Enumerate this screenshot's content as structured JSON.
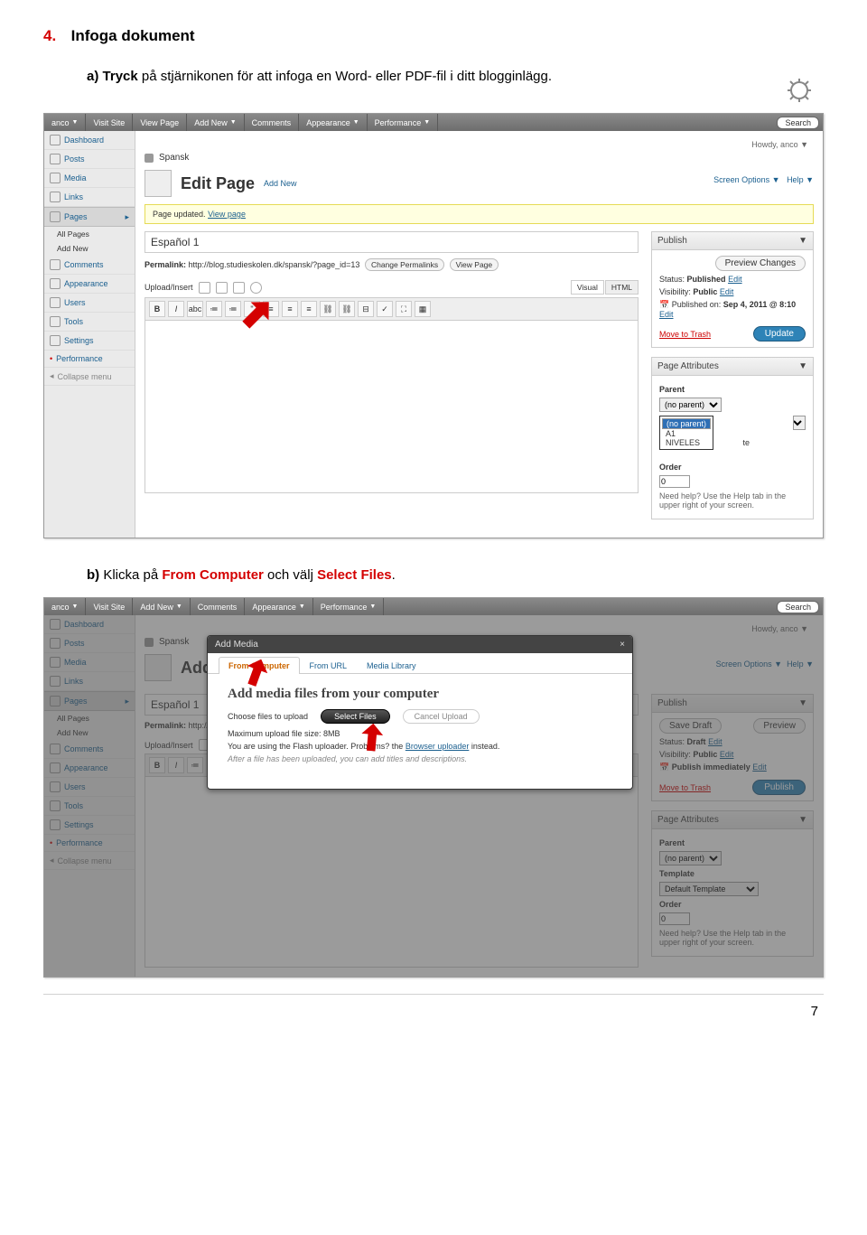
{
  "section": {
    "num": "4.",
    "title": "Infoga dokument"
  },
  "para_a": {
    "prefix": "a)",
    "bold": "Tryck",
    "rest": " på stjärnikonen för att infoga en Word- eller PDF-fil i ditt blogginlägg."
  },
  "topbar": {
    "site": "anco",
    "items": [
      "Visit Site",
      "View Page",
      "Add New",
      "Comments",
      "Appearance",
      "Performance"
    ],
    "search": "Search"
  },
  "howdy": "Howdy, anco",
  "breadcrumb": "Spansk",
  "edit_page": {
    "title": "Edit Page",
    "add_new": "Add New"
  },
  "screen_opts": "Screen Options",
  "help": "Help",
  "notice": {
    "text": "Page updated.",
    "link": "View page"
  },
  "editor": {
    "title": "Español 1",
    "permalink_label": "Permalink:",
    "permalink": "http://blog.studieskolen.dk/spansk/?page_id=13",
    "btn1": "Change Permalinks",
    "btn2": "View Page",
    "upload": "Upload/Insert",
    "tabs": [
      "Visual",
      "HTML"
    ]
  },
  "sidebar_s1": [
    {
      "label": "Dashboard"
    },
    {
      "label": "Posts"
    },
    {
      "label": "Media"
    },
    {
      "label": "Links"
    },
    {
      "label": "Pages",
      "active": true,
      "subs": [
        "All Pages",
        "Add New"
      ]
    },
    {
      "label": "Comments"
    },
    {
      "label": "Appearance"
    },
    {
      "label": "Users"
    },
    {
      "label": "Tools"
    },
    {
      "label": "Settings"
    },
    {
      "label": "Performance"
    }
  ],
  "collapse": "Collapse menu",
  "publish": {
    "h": "Publish",
    "preview": "Preview Changes",
    "status": "Status:",
    "status_v": "Published",
    "edit": "Edit",
    "vis": "Visibility:",
    "vis_v": "Public",
    "pub_on": "Published on:",
    "pub_v": "Sep 4, 2011 @ 8:10",
    "trash": "Move to Trash",
    "update": "Update"
  },
  "attrs": {
    "h": "Page Attributes",
    "parent": "Parent",
    "parent_v": "(no parent)",
    "dd": [
      "(no parent)",
      "A1",
      "NIVELES"
    ],
    "tmpl_hint": "te",
    "order": "Order",
    "order_v": "0",
    "help": "Need help? Use the Help tab in the upper right of your screen."
  },
  "para_b": {
    "prefix": "b)",
    "t1": " Klicka på ",
    "r1": "From Computer",
    "t2": " och välj ",
    "r2": "Select Files",
    "t3": "."
  },
  "s2": {
    "edit_title": "Add New",
    "status_v": "Draft",
    "vis_v": "Public",
    "pub_on": "Publish immediately",
    "save": "Save Draft",
    "preview": "Preview",
    "publish": "Publish",
    "tmpl": "Template",
    "tmpl_v": "Default Template"
  },
  "modal": {
    "h": "Add Media",
    "close": "×",
    "tabs": [
      "From Computer",
      "From URL",
      "Media Library"
    ],
    "title": "Add media files from your computer",
    "choose": "Choose files to upload",
    "select": "Select Files",
    "cancel": "Cancel Upload",
    "max": "Maximum upload file size: 8MB",
    "flash1": "You are using the Flash uploader. Problems? ",
    "flash2": "the ",
    "flash_link": "Browser uploader",
    "flash3": " instead.",
    "after": "After a file has been uploaded, you can add titles and descriptions."
  },
  "page_number": "7"
}
